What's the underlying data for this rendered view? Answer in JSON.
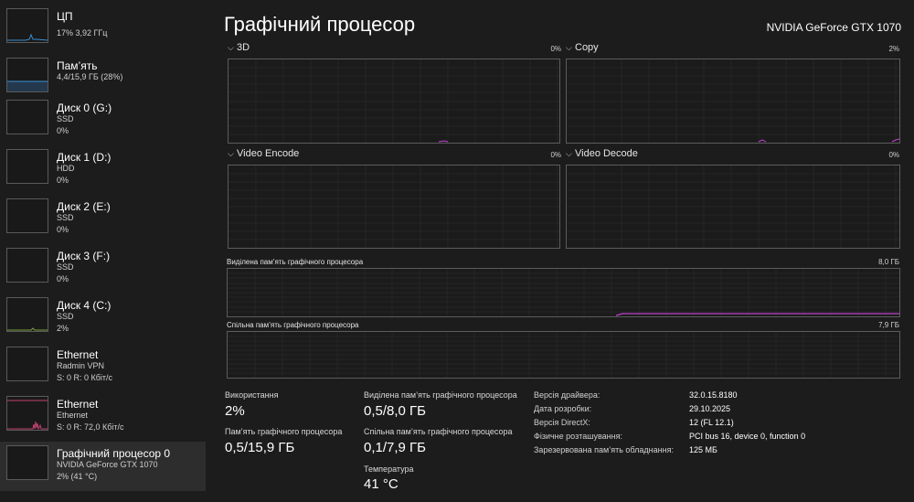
{
  "sidebar": {
    "items": [
      {
        "title": "ЦП",
        "line1": "17% 3,92 ГГц",
        "line2": ""
      },
      {
        "title": "Пам’ять",
        "line1": "4,4/15,9 ГБ (28%)",
        "line2": ""
      },
      {
        "title": "Диск 0 (G:)",
        "line1": "SSD",
        "line2": "0%"
      },
      {
        "title": "Диск 1 (D:)",
        "line1": "HDD",
        "line2": "0%"
      },
      {
        "title": "Диск 2 (E:)",
        "line1": "SSD",
        "line2": "0%"
      },
      {
        "title": "Диск 3 (F:)",
        "line1": "SSD",
        "line2": "0%"
      },
      {
        "title": "Диск 4 (C:)",
        "line1": "SSD",
        "line2": "2%"
      },
      {
        "title": "Ethernet",
        "line1": "Radmin VPN",
        "line2": "S: 0 R: 0 Кбіт/с"
      },
      {
        "title": "Ethernet",
        "line1": "Ethernet",
        "line2": "S: 0 R: 72,0 Кбіт/с"
      },
      {
        "title": "Графічний процесор 0",
        "line1": "NVIDIA GeForce GTX 1070",
        "line2": "2% (41 °C)"
      }
    ]
  },
  "header": {
    "title": "Графічний процесор",
    "gpu_model": "NVIDIA GeForce GTX 1070"
  },
  "panels": {
    "p3d": {
      "label": "3D",
      "value": "0%"
    },
    "copy": {
      "label": "Copy",
      "value": "2%"
    },
    "encode": {
      "label": "Video Encode",
      "value": "0%"
    },
    "decode": {
      "label": "Video Decode",
      "value": "0%"
    }
  },
  "memory_graphs": {
    "dedicated": {
      "label": "Виділена пам’ять графічного процесора",
      "value": "8,0 ГБ"
    },
    "shared": {
      "label": "Спільна пам’ять графічного процесора",
      "value": "7,9 ГБ"
    }
  },
  "stats": {
    "utilization": {
      "label": "Використання",
      "value": "2%"
    },
    "gpu_memory": {
      "label": "Пам’ять графічного процесора",
      "value": "0,5/15,9 ГБ"
    },
    "dedicated_memory": {
      "label": "Виділена пам’ять графічного процесора",
      "value": "0,5/8,0 ГБ"
    },
    "shared_memory": {
      "label": "Спільна пам’ять графічного процесора",
      "value": "0,1/7,9 ГБ"
    },
    "temperature": {
      "label": "Температура",
      "value": "41 °C"
    }
  },
  "info": [
    {
      "key": "Версія драйвера:",
      "value": "32.0.15.8180"
    },
    {
      "key": "Дата розробки:",
      "value": "29.10.2025"
    },
    {
      "key": "Версія DirectX:",
      "value": "12 (FL 12.1)"
    },
    {
      "key": "Фізичне розташування:",
      "value": "PCI bus 16, device 0, function 0"
    },
    {
      "key": "Зарезервована пам’ять обладнання:",
      "value": "125 МБ"
    }
  ],
  "colors": {
    "accent_gpu": "#c040d0",
    "accent_cpu": "#3a8fd0",
    "accent_ethernet": "#c04070",
    "graph_border": "#5c5c5c",
    "background": "#1c1c1c"
  },
  "icons": {
    "chevron": "chevron-down-icon"
  }
}
